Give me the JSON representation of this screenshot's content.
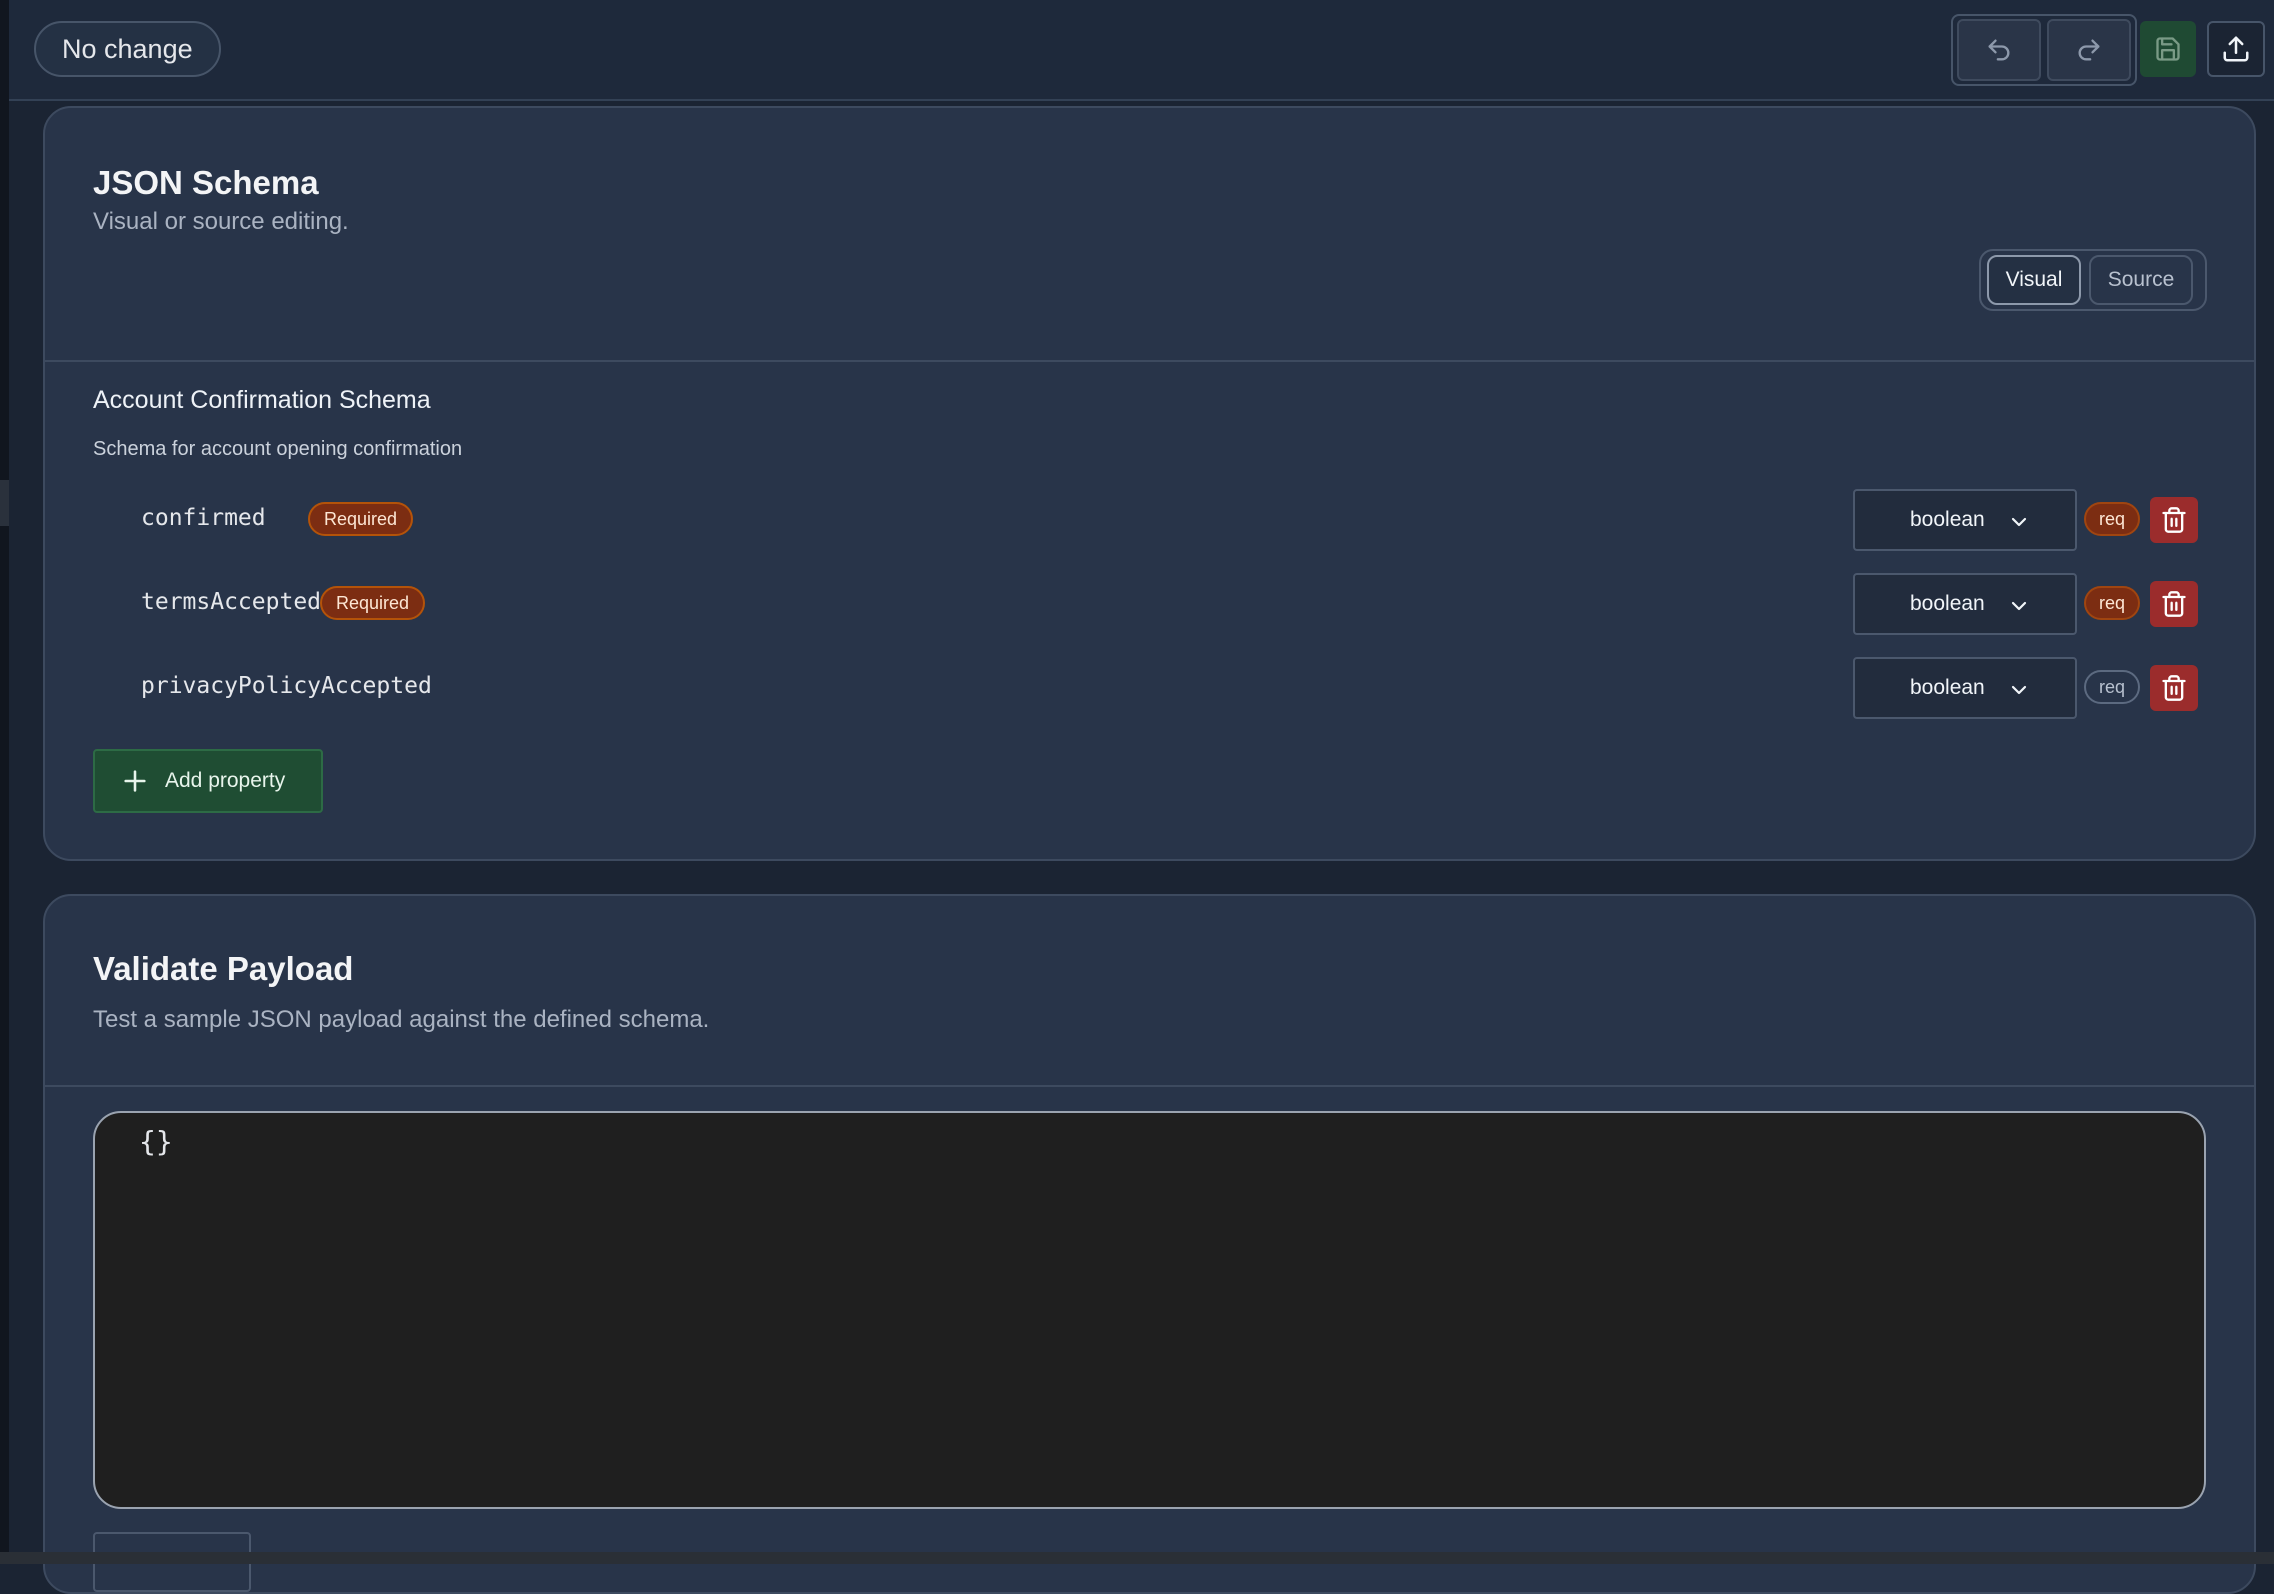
{
  "topbar": {
    "status": "No change"
  },
  "schema_card": {
    "title": "JSON Schema",
    "subtitle": "Visual or source editing.",
    "modes": {
      "visual": "Visual",
      "source": "Source",
      "active": "Visual"
    },
    "schema_title": "Account Confirmation Schema",
    "schema_description": "Schema for account opening confirmation",
    "properties": [
      {
        "name": "confirmed",
        "badge": "Required",
        "type": "boolean",
        "req_label": "req",
        "required": true
      },
      {
        "name": "termsAccepted",
        "badge": "Required",
        "type": "boolean",
        "req_label": "req",
        "required": true
      },
      {
        "name": "privacyPolicyAccepted",
        "badge": "",
        "type": "boolean",
        "req_label": "req",
        "required": false
      }
    ],
    "add_label": "Add property"
  },
  "validate_card": {
    "title": "Validate Payload",
    "subtitle": "Test a sample JSON payload against the defined schema.",
    "payload": "{}"
  },
  "icons": {
    "undo": "undo-icon",
    "redo": "redo-icon",
    "save": "save-icon",
    "export": "upload-icon",
    "dropdown": "chevron-down-icon",
    "delete": "trash-icon",
    "add": "plus-icon"
  },
  "colors": {
    "background": "#1b2433",
    "card": "#283449",
    "required_badge": "#7c2d12",
    "delete": "#9b2c2c",
    "add_button": "#1f4d33",
    "save_button": "#1f4a33",
    "editor": "#1f1f1f"
  }
}
